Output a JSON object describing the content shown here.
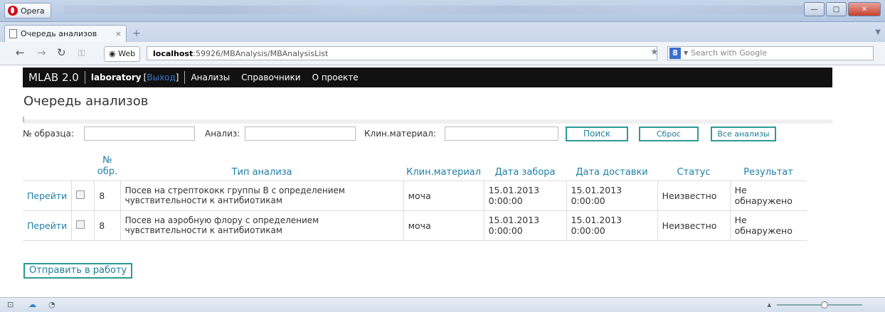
{
  "window": {
    "app_name": "Opera"
  },
  "tab": {
    "title": "Очередь анализов",
    "close": "×",
    "new": "+"
  },
  "addressbar": {
    "web_label": "Web",
    "url_host": "localhost",
    "url_rest": ":59926/MBAnalysis/MBAnalysisList",
    "search_placeholder": "Search with Google",
    "search_engine_glyph": "8"
  },
  "header": {
    "brand": "MLAB 2.0",
    "user": "laboratory",
    "exit_open": "[",
    "exit_label": "Выход",
    "exit_close": "]",
    "menu": [
      "Анализы",
      "Справочники",
      "О проекте"
    ]
  },
  "page": {
    "title": "Очередь анализов"
  },
  "filters": {
    "sample_label": "№ образца:",
    "analysis_label": "Анализ:",
    "material_label": "Клин.материал:",
    "search_button": "Поиск",
    "reset_button": "Сброс",
    "all_button": "Все анализы"
  },
  "table": {
    "headers": [
      "№ обр.",
      "Тип анализа",
      "Клин.материал",
      "Дата забора",
      "Дата доставки",
      "Статус",
      "Результат"
    ],
    "rows": [
      {
        "action": "Перейти",
        "number": "8",
        "type": "Посев на стрептококк группы В с определением чувствительности к антибиотикам",
        "material": "моча",
        "collected": "15.01.2013 0:00:00",
        "delivered": "15.01.2013 0:00:00",
        "status": "Неизвестно",
        "result": "Не обнаружено"
      },
      {
        "action": "Перейти",
        "number": "8",
        "type": "Посев на аэробную флору с определением чувствительности к антибиотикам",
        "material": "моча",
        "collected": "15.01.2013 0:00:00",
        "delivered": "15.01.2013 0:00:00",
        "status": "Неизвестно",
        "result": "Не обнаружено"
      }
    ]
  },
  "actions": {
    "send_button": "Отправить в работу"
  },
  "colors": {
    "link": "#1e7fa6",
    "button_border": "#2d9a93",
    "header_bg": "#111111",
    "exit_link": "#3a79c8"
  }
}
